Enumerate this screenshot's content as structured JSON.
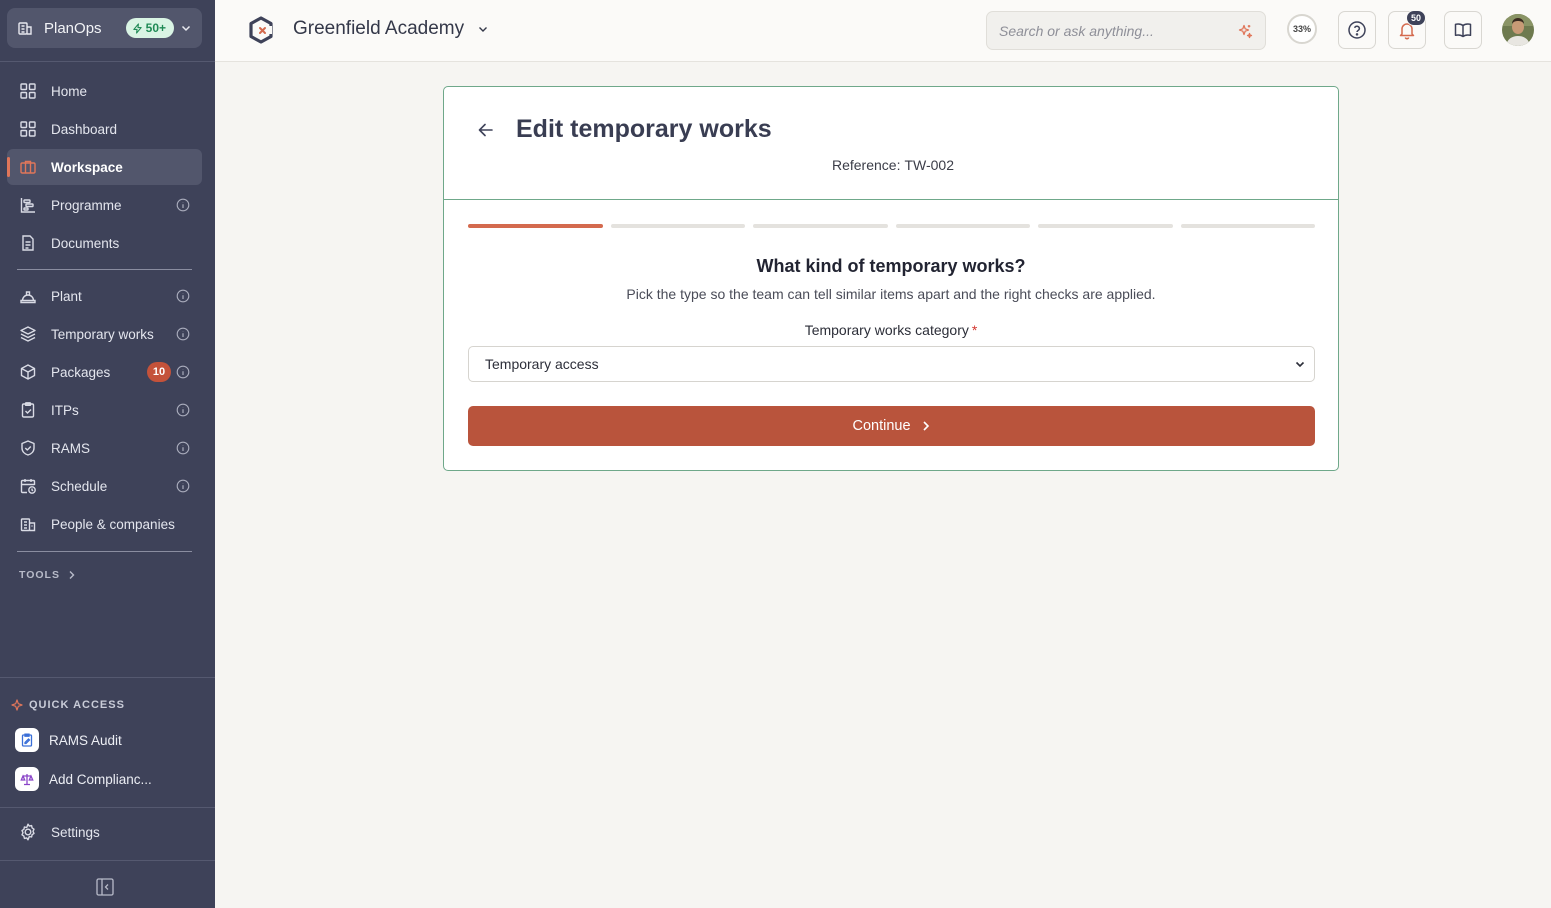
{
  "colors": {
    "sidebar": "#3e4259",
    "accent": "#b9543c",
    "active_marker": "#e0765a",
    "card_border": "#6fa88a"
  },
  "org": {
    "name": "PlanOps",
    "badge": "50+",
    "icon": "building-icon"
  },
  "nav_main": [
    {
      "label": "Home",
      "icon": "grid-icon"
    },
    {
      "label": "Dashboard",
      "icon": "grid-icon"
    },
    {
      "label": "Workspace",
      "icon": "briefcase-icon",
      "active": true
    },
    {
      "label": "Programme",
      "icon": "gantt-icon",
      "info": true
    },
    {
      "label": "Documents",
      "icon": "document-icon"
    }
  ],
  "nav_secondary": [
    {
      "label": "Plant",
      "icon": "hard-hat-icon",
      "info": true
    },
    {
      "label": "Temporary works",
      "icon": "layers-icon",
      "info": true
    },
    {
      "label": "Packages",
      "icon": "package-icon",
      "badge": "10",
      "info": true
    },
    {
      "label": "ITPs",
      "icon": "clipboard-check-icon",
      "info": true
    },
    {
      "label": "RAMS",
      "icon": "shield-check-icon",
      "info": true
    },
    {
      "label": "Schedule",
      "icon": "calendar-clock-icon",
      "info": true
    },
    {
      "label": "People & companies",
      "icon": "building-people-icon"
    }
  ],
  "tools_label": "TOOLS",
  "quick_access": {
    "title": "QUICK ACCESS",
    "items": [
      {
        "label": "RAMS Audit",
        "icon": "clipboard-edit-icon"
      },
      {
        "label": "Add Complianc...",
        "icon": "scales-icon"
      }
    ]
  },
  "settings_label": "Settings",
  "header": {
    "project": "Greenfield Academy",
    "search_placeholder": "Search or ask anything...",
    "progress": "33%",
    "notifications": "50"
  },
  "form": {
    "title": "Edit temporary works",
    "reference_label": "Reference:",
    "reference": "TW-002",
    "steps_total": 6,
    "steps_done": 1,
    "question": "What kind of temporary works?",
    "subtitle": "Pick the type so the team can tell similar items apart and the right checks are applied.",
    "field_label": "Temporary works category",
    "required_mark": "*",
    "selected": "Temporary access",
    "continue_label": "Continue"
  }
}
